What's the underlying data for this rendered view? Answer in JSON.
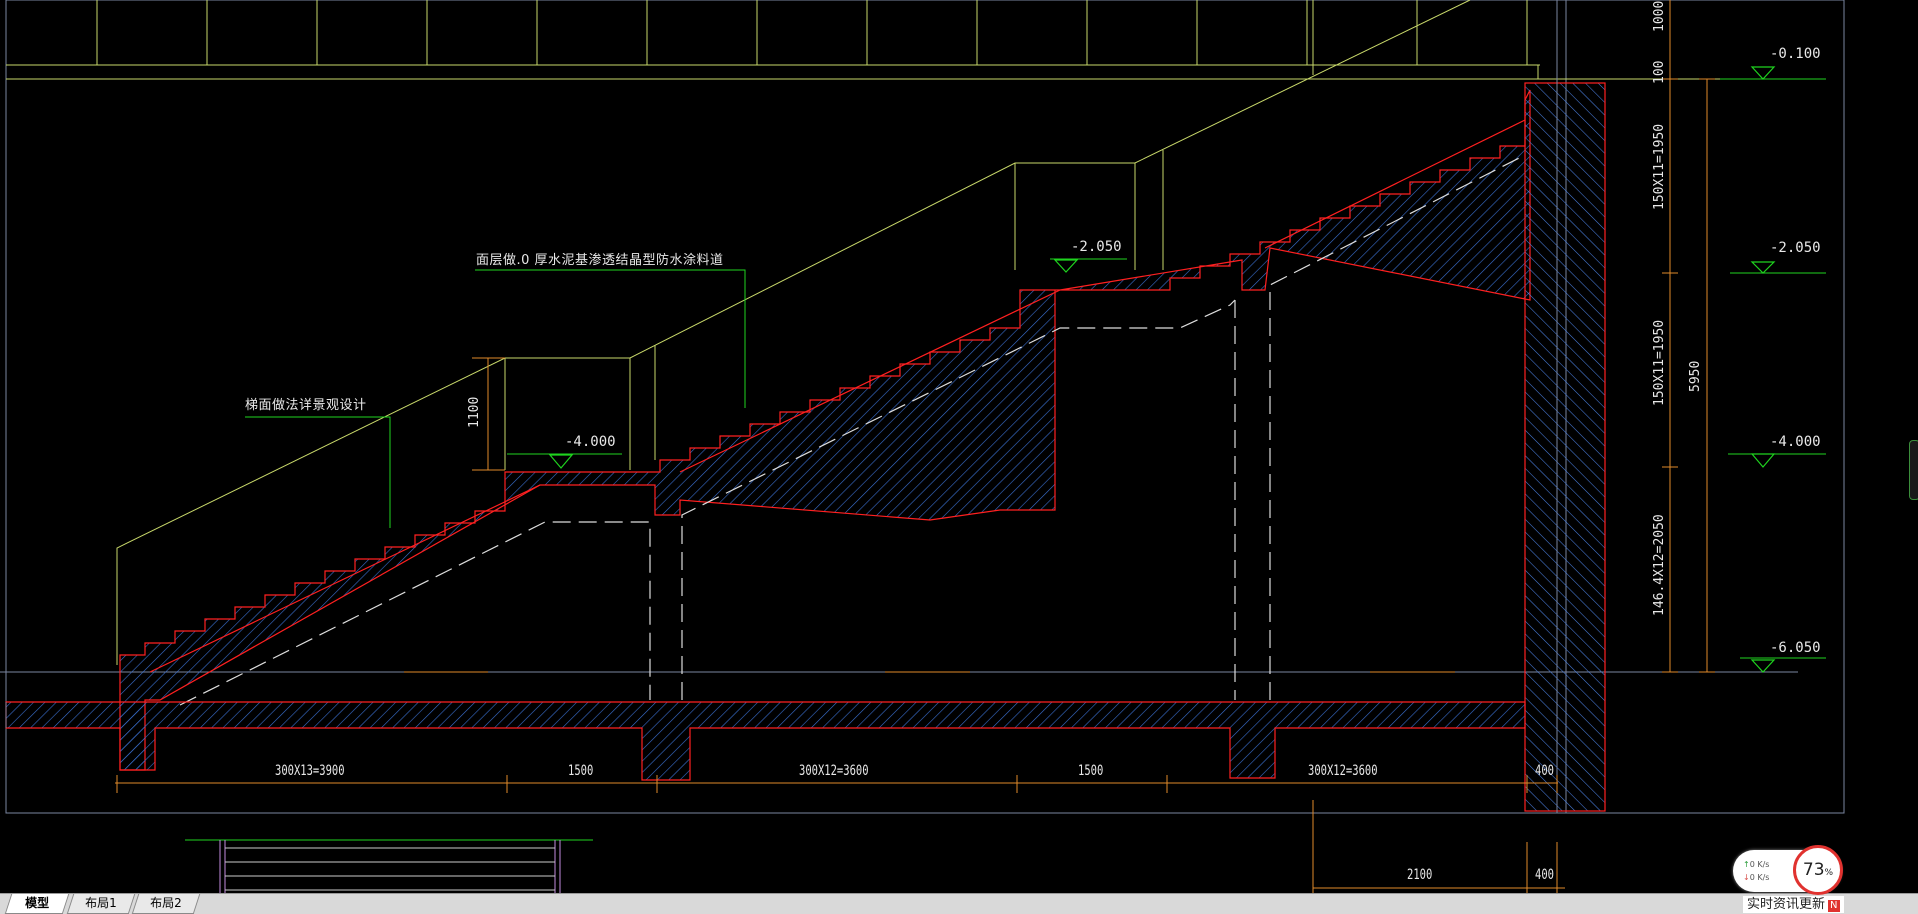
{
  "annotations": {
    "note_waterproof": "面层做.0 厚水泥基渗透结晶型防水涂料道",
    "note_landscape": "梯面做法详景观设计"
  },
  "elevations": {
    "e1": "-0.100",
    "e2": "-2.050",
    "e3": "-4.000",
    "e4": "-6.050",
    "mid_upper": "-2.050",
    "mid_lower": "-4.000"
  },
  "dimensions": {
    "bottom": [
      "300X13=3900",
      "1500",
      "300X12=3600",
      "1500",
      "300X12=3600",
      "400"
    ],
    "lower": [
      "2100",
      "400"
    ],
    "railing_height": "1100",
    "right_segments": [
      "1000",
      "100",
      "150X11=1950",
      "150X11=1950",
      "146.4X12=2050"
    ],
    "right_total": "5950"
  },
  "tabs": [
    "模型",
    "布局1",
    "布局2"
  ],
  "network": {
    "up": "0",
    "down": "0",
    "unit": "K/s",
    "cpu": "73",
    "cpu_unit": "%"
  },
  "news": {
    "label": "实时资讯更新",
    "badge": "N"
  },
  "colors": {
    "background": "#000000",
    "concrete_outline": "#ff2020",
    "hatch": "#3a6fd0",
    "railing": "#c8d86a",
    "leader": "#1fd41f",
    "dimension": "#e08a2a"
  }
}
